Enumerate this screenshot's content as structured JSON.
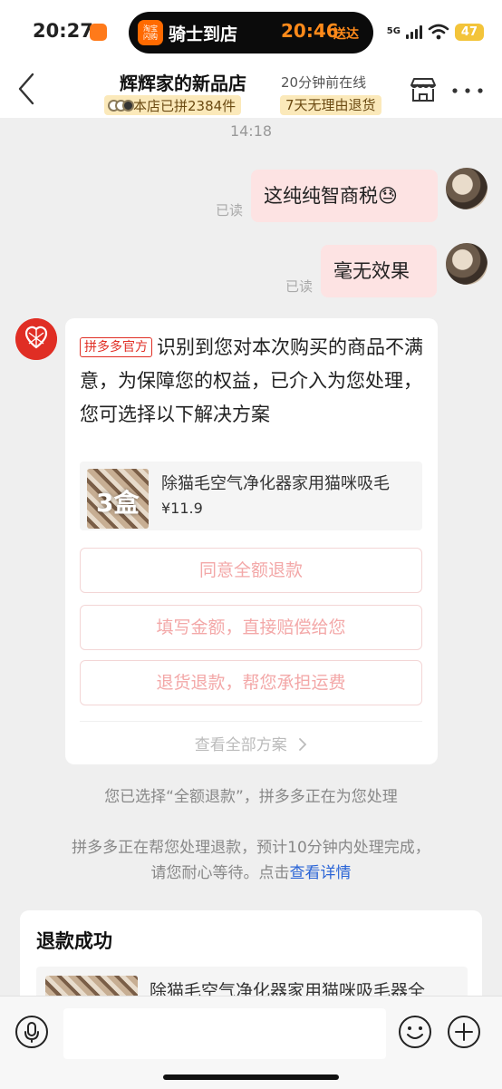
{
  "status_bar": {
    "time": "20:27",
    "island_app_lines": [
      "淘宝",
      "闪购"
    ],
    "island_title": "骑士到店",
    "island_time": "20:46",
    "island_status": "送达",
    "network": "5G",
    "battery": "47"
  },
  "header": {
    "shop_name": "辉辉家的新品店",
    "online_status": "20分钟前在线",
    "group_tag": "本店已拼2384件",
    "return_tag": "7天无理由退货"
  },
  "chat": {
    "timestamp": "14:18",
    "messages": [
      {
        "text": "这纯纯智商税😓",
        "read": "已读"
      },
      {
        "text": "毫无效果",
        "read": "已读"
      }
    ],
    "official_card": {
      "badge": "拼多多官方",
      "text": "识别到您对本次购买的商品不满意，为保障您的权益，已介入为您处理，您可选择以下解决方案",
      "product": {
        "thumb_label": "3盒",
        "title": "除猫毛空气净化器家用猫咪吸毛",
        "price": "¥11.9"
      },
      "options": [
        "同意全额退款",
        "填写金额，直接赔偿给您",
        "退货退款，帮您承担运费"
      ],
      "view_all": "查看全部方案"
    },
    "system_msg_1": "您已选择“全额退款”，拼多多正在为您处理",
    "system_msg_2_line1": "拼多多正在帮您处理退款，预计10分钟内处理完成，",
    "system_msg_2_line2": "请您耐心等待。点击",
    "system_msg_2_link": "查看详情",
    "refund_card": {
      "title": "退款成功",
      "product_name": "除猫毛空气净化器家用猫咪吸毛器全"
    }
  },
  "input": {
    "placeholder": ""
  },
  "colors": {
    "accent_red": "#e02e24",
    "bubble_pink": "#fde3e3",
    "link_blue": "#2a64d6",
    "tag_yellow": "#fbe9ba"
  }
}
